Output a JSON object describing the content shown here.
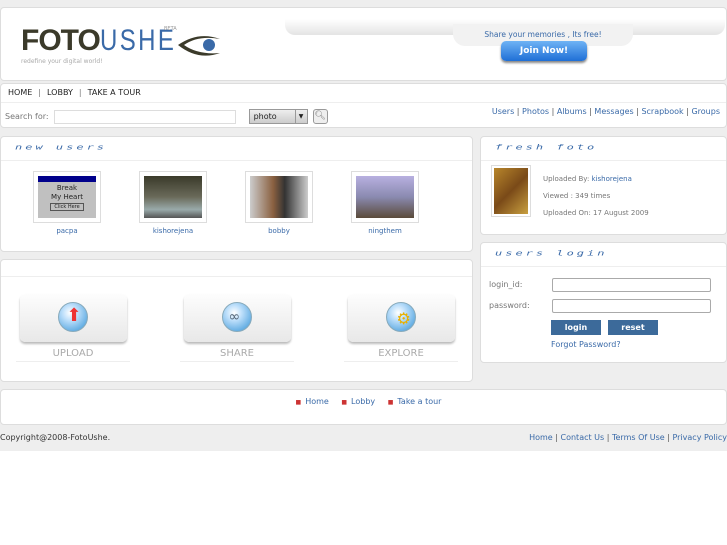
{
  "header": {
    "logo_bold": "FOTO",
    "logo_light": "USHE",
    "beta": "BETA",
    "tagline": "redefine your digital world!",
    "share_text": "Share your memories , Its free!",
    "join_button": "Join Now!"
  },
  "nav": {
    "items": [
      "HOME",
      "LOBBY",
      "TAKE A TOUR"
    ]
  },
  "search": {
    "label": "Search for:",
    "value": "",
    "select": "photo"
  },
  "top_links": [
    "Users",
    "Photos",
    "Albums",
    "Messages",
    "Scrapbook",
    "Groups"
  ],
  "new_users": {
    "title": "new users",
    "users": [
      {
        "name": "pacpa",
        "thumb_text": [
          "Break",
          "My Heart",
          "Click Here"
        ]
      },
      {
        "name": "kishorejena"
      },
      {
        "name": "bobby"
      },
      {
        "name": "ningthem"
      }
    ]
  },
  "actions": [
    {
      "label": "UPLOAD"
    },
    {
      "label": "SHARE"
    },
    {
      "label": "EXPLORE"
    }
  ],
  "fresh": {
    "title": "fresh foto",
    "uploaded_by_label": "Uploaded By:",
    "uploaded_by": "kishorejena",
    "viewed": "Viewed : 349 times",
    "uploaded_on": "Uploaded On: 17 August 2009"
  },
  "login": {
    "title": "users login",
    "id_label": "login_id:",
    "pw_label": "password:",
    "login": "login",
    "reset": "reset",
    "forgot": "Forgot Password?"
  },
  "footer": {
    "links": [
      "Home",
      "Lobby",
      "Take a tour"
    ],
    "copyright": "Copyright@2008-FotoUshe.",
    "bottom_links": [
      "Home",
      "Contact Us",
      "Terms Of Use",
      "Privacy Policy"
    ]
  }
}
